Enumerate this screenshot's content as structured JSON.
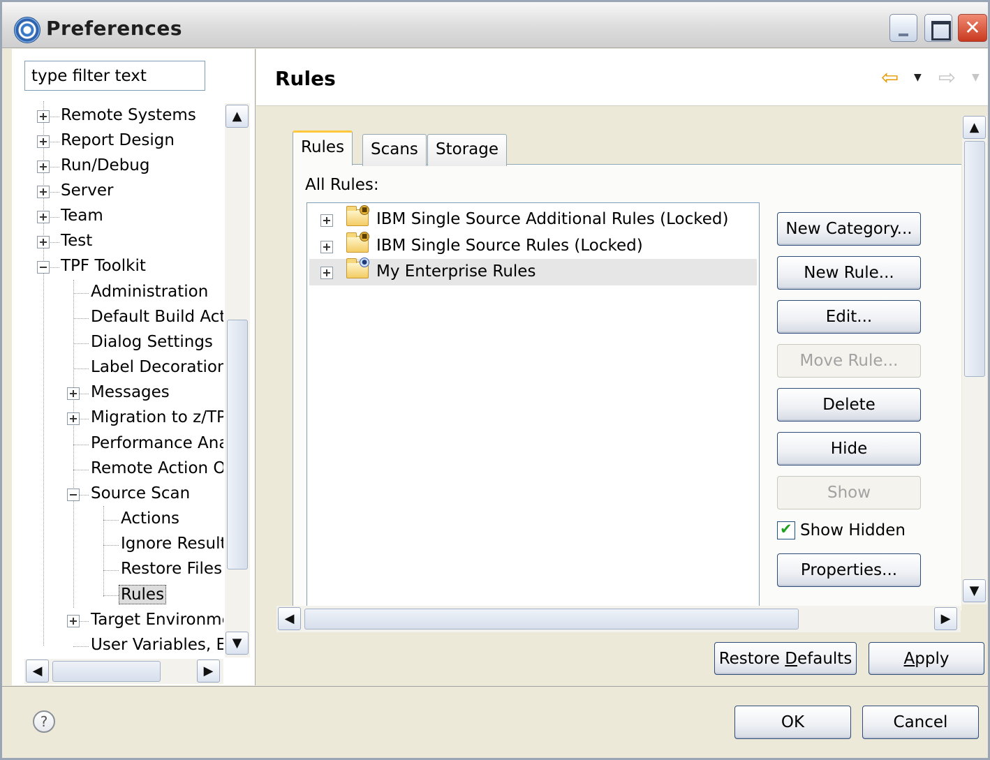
{
  "window": {
    "title": "Preferences"
  },
  "filter": {
    "placeholder": "type filter text"
  },
  "tree": {
    "items": [
      {
        "label": "Remote Systems"
      },
      {
        "label": "Report Design"
      },
      {
        "label": "Run/Debug"
      },
      {
        "label": "Server"
      },
      {
        "label": "Team"
      },
      {
        "label": "Test"
      },
      {
        "label": "TPF Toolkit"
      },
      {
        "label": "Administration"
      },
      {
        "label": "Default Build Actic"
      },
      {
        "label": "Dialog Settings"
      },
      {
        "label": "Label Decorations"
      },
      {
        "label": "Messages"
      },
      {
        "label": "Migration to z/TPF"
      },
      {
        "label": "Performance Ana"
      },
      {
        "label": "Remote Action Op"
      },
      {
        "label": "Source Scan"
      },
      {
        "label": "Actions"
      },
      {
        "label": "Ignore Result"
      },
      {
        "label": "Restore Files"
      },
      {
        "label": "Rules"
      },
      {
        "label": "Target Environme"
      },
      {
        "label": "User Variables, E:"
      }
    ]
  },
  "page": {
    "title": "Rules"
  },
  "tabs": [
    {
      "label": "Rules"
    },
    {
      "label": "Scans"
    },
    {
      "label": "Storage"
    }
  ],
  "rules_panel": {
    "all_rules_label": "All Rules:",
    "categories": [
      {
        "label": "IBM Single Source Additional Rules (Locked)"
      },
      {
        "label": "IBM Single Source Rules (Locked)"
      },
      {
        "label": "My Enterprise Rules"
      }
    ],
    "buttons": {
      "new_category": "New Category...",
      "new_rule": "New Rule...",
      "edit": "Edit...",
      "move_rule": "Move Rule...",
      "delete": "Delete",
      "hide": "Hide",
      "show": "Show",
      "properties": "Properties..."
    },
    "show_hidden_label": "Show Hidden"
  },
  "page_buttons": {
    "restore_defaults_pre": "Restore ",
    "restore_defaults_mnemonic": "D",
    "restore_defaults_post": "efaults",
    "apply_mnemonic": "A",
    "apply_post": "pply"
  },
  "dialog_buttons": {
    "ok": "OK",
    "cancel": "Cancel"
  },
  "icons": {
    "app": "preferences-gear-icon",
    "back": "back-arrow-icon",
    "forward": "forward-arrow-icon",
    "help": "help-icon",
    "folder": "folder-icon"
  },
  "colors": {
    "accent_tab": "#ffc83c",
    "back_arrow": "#e59a00",
    "checkmark": "#21a121",
    "close_button": "#c8391f"
  }
}
